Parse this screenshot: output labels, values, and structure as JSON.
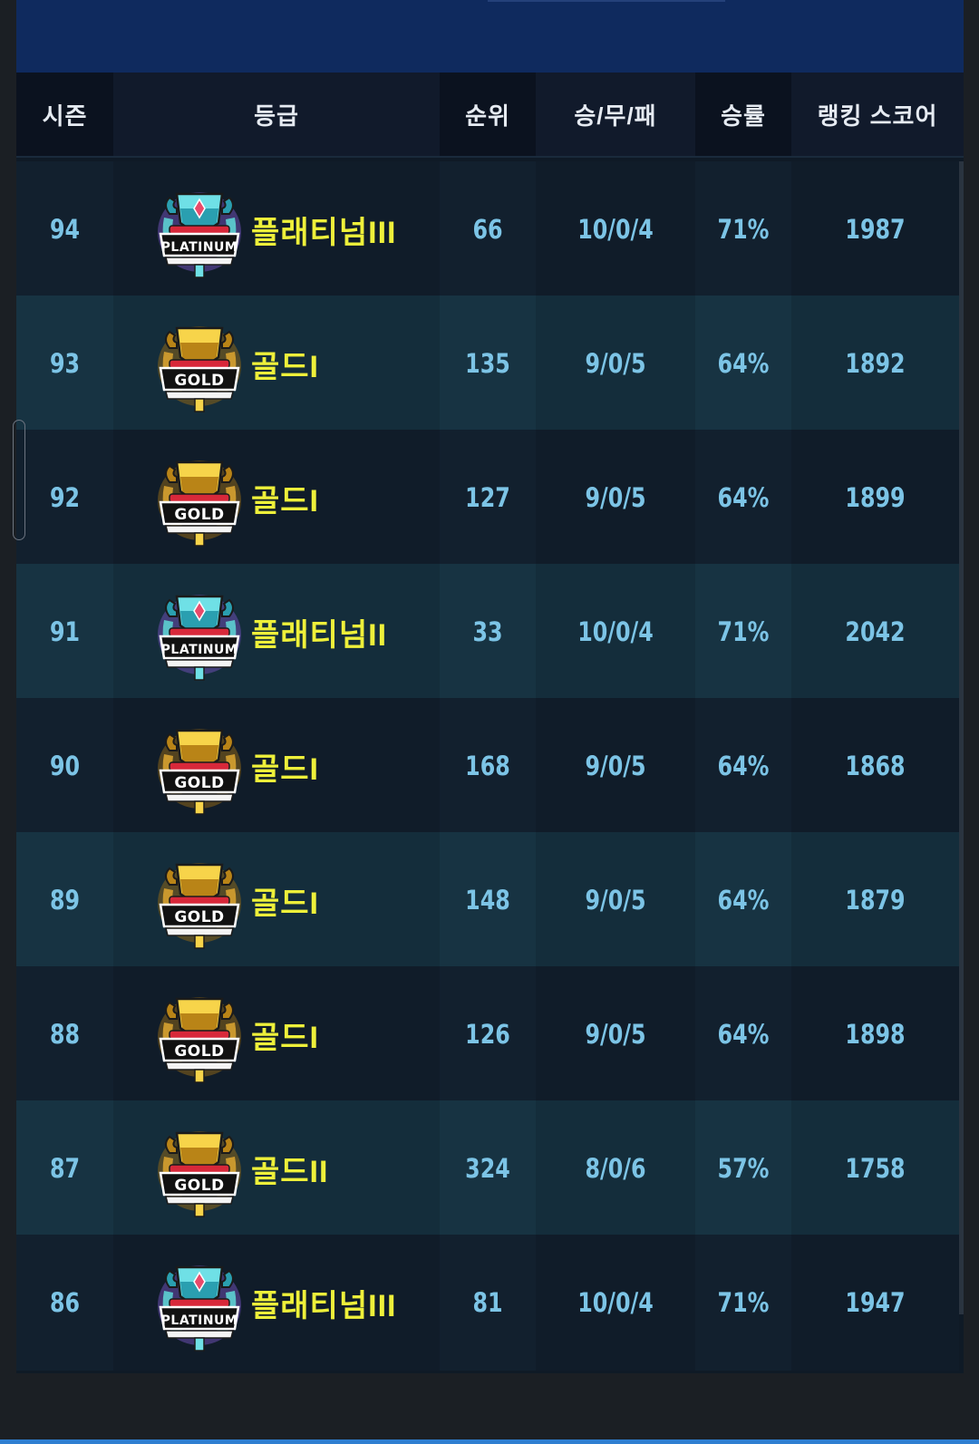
{
  "header": {
    "season": "시즌",
    "grade": "등급",
    "rank": "순위",
    "wdl": "승/무/패",
    "winrate": "승률",
    "score": "랭킹 스코어"
  },
  "rows": [
    {
      "season": "94",
      "tier": "platinum",
      "badge_text": "PLATINUM",
      "grade": "플래티넘III",
      "rank": "66",
      "wdl": "10/0/4",
      "winrate": "71%",
      "score": "1987"
    },
    {
      "season": "93",
      "tier": "gold",
      "badge_text": "GOLD",
      "grade": "골드I",
      "rank": "135",
      "wdl": "9/0/5",
      "winrate": "64%",
      "score": "1892"
    },
    {
      "season": "92",
      "tier": "gold",
      "badge_text": "GOLD",
      "grade": "골드I",
      "rank": "127",
      "wdl": "9/0/5",
      "winrate": "64%",
      "score": "1899"
    },
    {
      "season": "91",
      "tier": "platinum",
      "badge_text": "PLATINUM",
      "grade": "플래티넘II",
      "rank": "33",
      "wdl": "10/0/4",
      "winrate": "71%",
      "score": "2042"
    },
    {
      "season": "90",
      "tier": "gold",
      "badge_text": "GOLD",
      "grade": "골드I",
      "rank": "168",
      "wdl": "9/0/5",
      "winrate": "64%",
      "score": "1868"
    },
    {
      "season": "89",
      "tier": "gold",
      "badge_text": "GOLD",
      "grade": "골드I",
      "rank": "148",
      "wdl": "9/0/5",
      "winrate": "64%",
      "score": "1879"
    },
    {
      "season": "88",
      "tier": "gold",
      "badge_text": "GOLD",
      "grade": "골드I",
      "rank": "126",
      "wdl": "9/0/5",
      "winrate": "64%",
      "score": "1898"
    },
    {
      "season": "87",
      "tier": "gold",
      "badge_text": "GOLD",
      "grade": "골드II",
      "rank": "324",
      "wdl": "8/0/6",
      "winrate": "57%",
      "score": "1758"
    },
    {
      "season": "86",
      "tier": "platinum",
      "badge_text": "PLATINUM",
      "grade": "플래티넘III",
      "rank": "81",
      "wdl": "10/0/4",
      "winrate": "71%",
      "score": "1947"
    }
  ],
  "colors": {
    "grade_text": "#eef03a",
    "value_text": "#7cc4e6",
    "header_text": "#e6ebf2",
    "banner": "#0f2a5e",
    "row_dark": "#12202e",
    "row_light": "#173342"
  }
}
